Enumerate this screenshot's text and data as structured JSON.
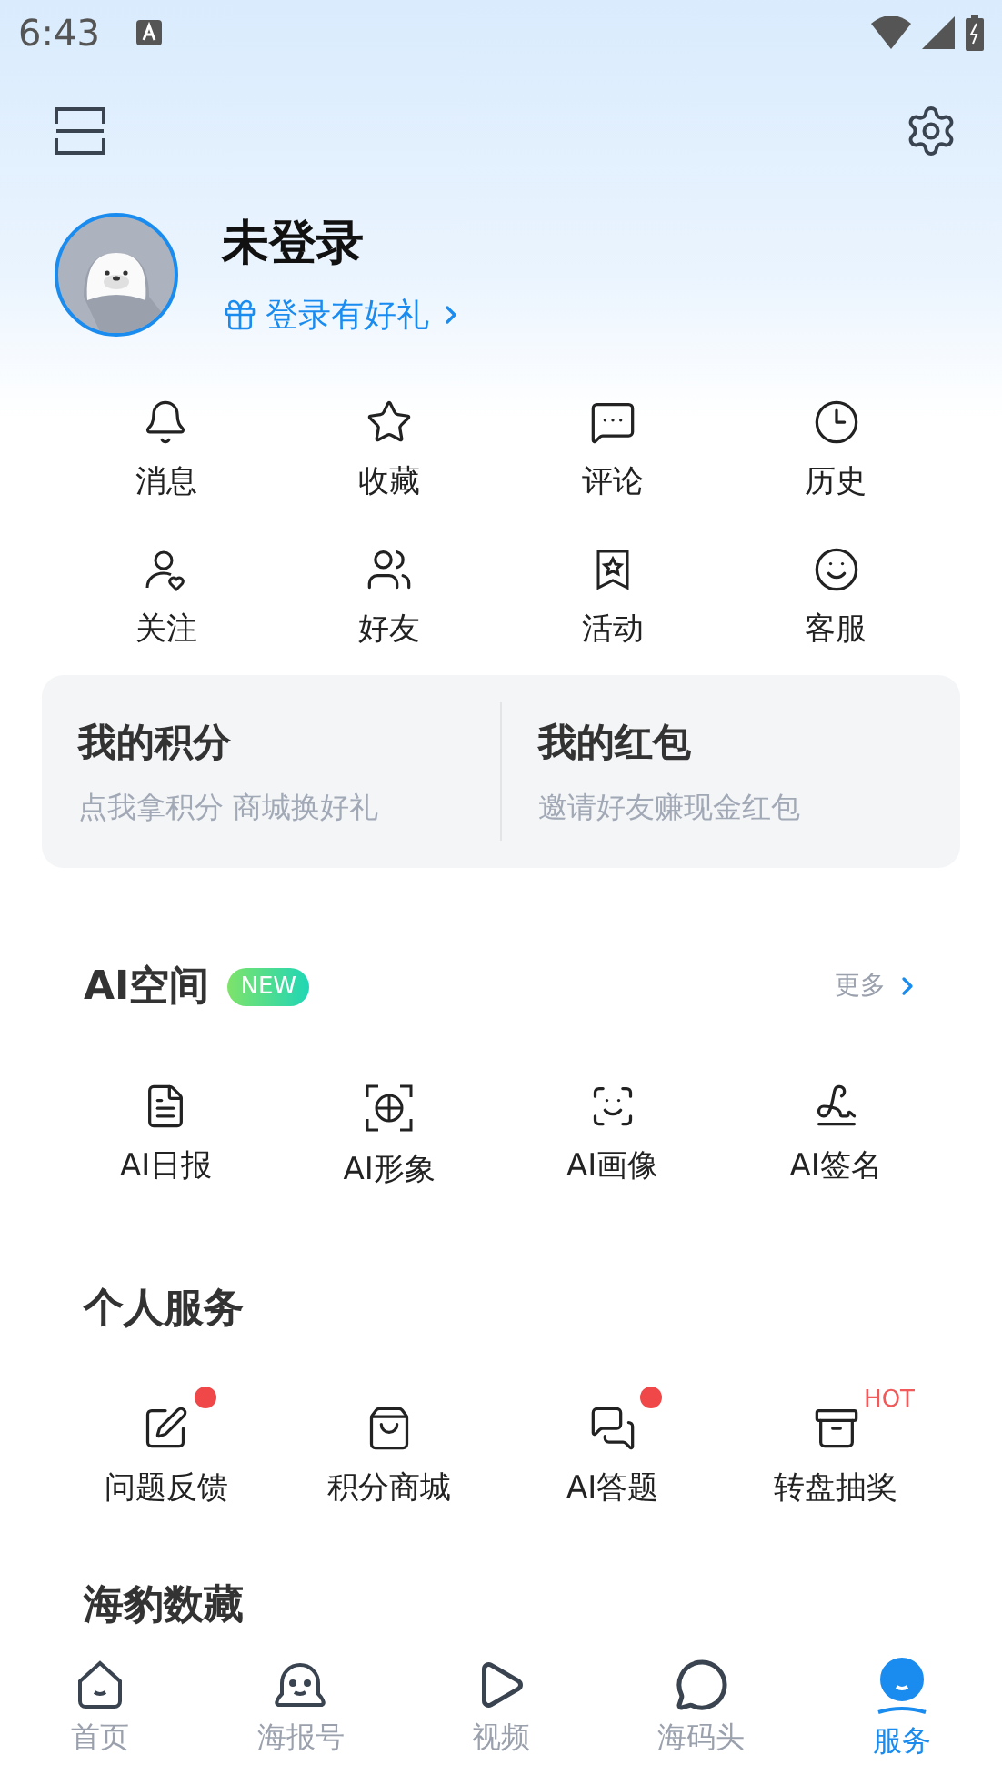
{
  "status_bar": {
    "time": "6:43"
  },
  "profile": {
    "name": "未登录",
    "login_link": "登录有好礼"
  },
  "shortcuts": [
    {
      "label": "消息"
    },
    {
      "label": "收藏"
    },
    {
      "label": "评论"
    },
    {
      "label": "历史"
    },
    {
      "label": "关注"
    },
    {
      "label": "好友"
    },
    {
      "label": "活动"
    },
    {
      "label": "客服"
    }
  ],
  "wallet_cards": [
    {
      "title": "我的积分",
      "subtitle": "点我拿积分 商城换好礼"
    },
    {
      "title": "我的红包",
      "subtitle": "邀请好友赚现金红包"
    }
  ],
  "ai_space": {
    "title": "AI空间",
    "badge": "NEW",
    "more": "更多",
    "items": [
      {
        "label": "AI日报"
      },
      {
        "label": "AI形象"
      },
      {
        "label": "AI画像"
      },
      {
        "label": "AI签名"
      }
    ]
  },
  "personal_services": {
    "title": "个人服务",
    "items": [
      {
        "label": "问题反馈",
        "dot": true
      },
      {
        "label": "积分商城",
        "dot": false
      },
      {
        "label": "AI答题",
        "dot": true
      },
      {
        "label": "转盘抽奖",
        "dot": false,
        "badge": "HOT"
      }
    ]
  },
  "next_section": {
    "title": "海豹数藏"
  },
  "tab_bar": [
    {
      "label": "首页",
      "selected": false
    },
    {
      "label": "海报号",
      "selected": false
    },
    {
      "label": "视频",
      "selected": false
    },
    {
      "label": "海码头",
      "selected": false
    },
    {
      "label": "服务",
      "selected": true
    }
  ]
}
